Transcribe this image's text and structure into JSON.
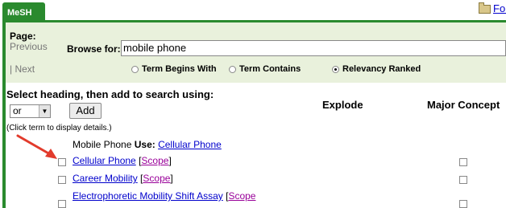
{
  "tabs": [
    {
      "label": "MeSH"
    }
  ],
  "header_link": "Fol",
  "browse": {
    "page_label": "Page:",
    "previous": "Previous",
    "next": "| Next",
    "browse_label": "Browse for:",
    "query": "mobile phone",
    "modes": [
      {
        "label": "Term Begins With",
        "selected": false
      },
      {
        "label": "Term Contains",
        "selected": false
      },
      {
        "label": "Relevancy Ranked",
        "selected": true
      }
    ]
  },
  "select_heading": "Select heading, then add to search using:",
  "operator": "or",
  "add_label": "Add",
  "col_explode": "Explode",
  "col_major": "Major Concept",
  "click_note": "(Click term to display details.)",
  "use_row": {
    "term": "Mobile Phone",
    "use_label": "Use:",
    "target": "Cellular Phone"
  },
  "results": [
    {
      "term": "Cellular Phone",
      "scope": "Scope"
    },
    {
      "term": "Career Mobility",
      "scope": "Scope"
    },
    {
      "term": "Electrophoretic Mobility Shift Assay",
      "scope": "Scope"
    }
  ],
  "colors": {
    "accent": "#2a8a2e",
    "panel": "#e9f1dc",
    "link": "#0000cc",
    "scope": "#990099",
    "arrow": "#e23b2c"
  }
}
